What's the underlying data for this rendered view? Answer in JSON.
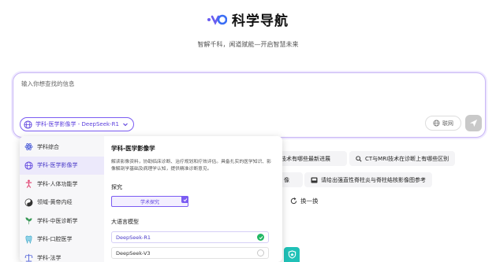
{
  "header": {
    "title": "科学导航",
    "tagline": "智解千科，闻道赋能—开启智慧未来"
  },
  "search": {
    "placeholder": "输入你想查找的信息",
    "model_select_label": "学科-医学影像学 - DeepSeek-R1",
    "net_label": "联网"
  },
  "chips": [
    "技术有哪些最新进展",
    "CT与MRI技术在诊断上有哪些区别",
    "像",
    "请给出强直性脊柱炎与脊柱结核影像图参考"
  ],
  "refresh_label": "换一换",
  "categories": [
    {
      "label": "学科综合",
      "icon": "atom-icon",
      "active": false
    },
    {
      "label": "学科-医学影像学",
      "icon": "globe-icon",
      "active": true
    },
    {
      "label": "学科-人体功能学",
      "icon": "body-icon",
      "active": false
    },
    {
      "label": "领域-黄帝内经",
      "icon": "taiji-icon",
      "active": false
    },
    {
      "label": "学科-中医诊断学",
      "icon": "herb-icon",
      "active": false
    },
    {
      "label": "学科-口腔医学",
      "icon": "tooth-icon",
      "active": false
    },
    {
      "label": "学科-法学",
      "icon": "scale-icon",
      "active": false
    }
  ],
  "detail": {
    "title": "学科-医学影像学",
    "description": "解读影像资料，协助临床诊断、治疗规划和疗效评估。具备扎实的医学知识、影像解剖学基础及病理学认知，提供精准诊断意见。",
    "explore_section": "探究",
    "explore_tag": "学术探究",
    "models_section": "大语言模型",
    "models": [
      {
        "name": "DeepSeek-R1",
        "selected": true
      },
      {
        "name": "DeepSeek-V3",
        "selected": false
      }
    ]
  },
  "colors": {
    "accent": "#7b5cf2",
    "selected_green": "#22b864",
    "badge_teal": "#20c1b7"
  }
}
